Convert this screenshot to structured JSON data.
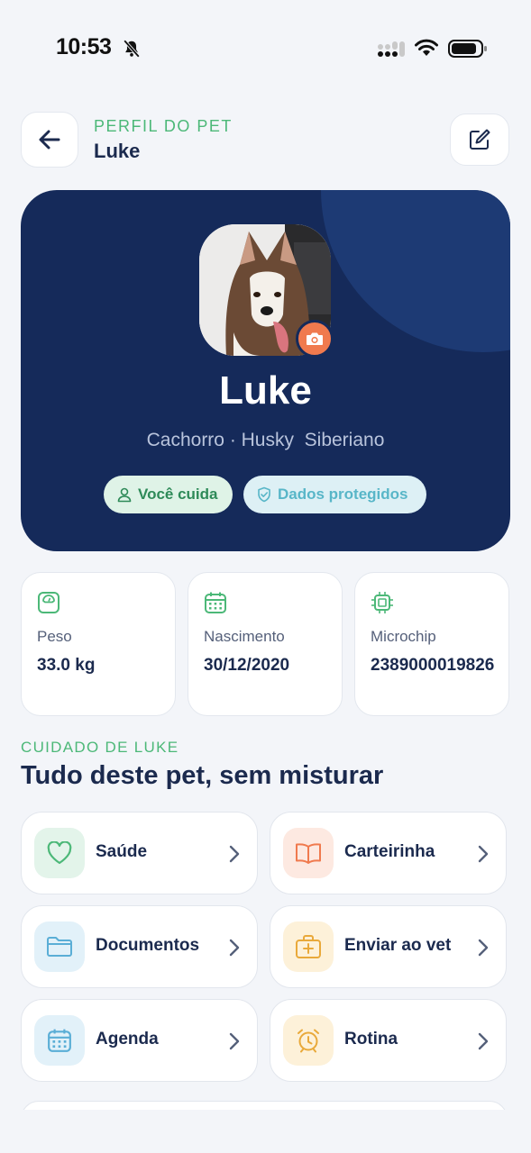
{
  "status_bar": {
    "time": "10:53"
  },
  "header": {
    "eyebrow": "PERFIL DO PET",
    "title": "Luke"
  },
  "hero": {
    "name": "Luke",
    "description": "Cachorro · Husky  Siberiano",
    "chips": [
      "Você cuida",
      "Dados protegidos"
    ]
  },
  "info": [
    {
      "label": "Peso",
      "value": "33.0 kg",
      "icon": "scale-icon"
    },
    {
      "label": "Nascimento",
      "value": "30/12/2020",
      "icon": "calendar-icon"
    },
    {
      "label": "Microchip",
      "value": "2389000019826",
      "icon": "chip-icon"
    }
  ],
  "section": {
    "eyebrow": "CUIDADO DE LUKE",
    "title": "Tudo deste pet, sem misturar"
  },
  "menu": [
    {
      "label": "Saúde",
      "icon": "heart-icon",
      "color": "#4cb878"
    },
    {
      "label": "Carteirinha",
      "icon": "book-icon",
      "color": "#f07a4e"
    },
    {
      "label": "Documentos",
      "icon": "folder-icon",
      "color": "#5aaed6"
    },
    {
      "label": "Enviar ao vet",
      "icon": "medical-kit-icon",
      "color": "#e9a93a"
    },
    {
      "label": "Agenda",
      "icon": "calendar-icon",
      "color": "#5aaed6"
    },
    {
      "label": "Rotina",
      "icon": "alarm-clock-icon",
      "color": "#e9a93a"
    }
  ],
  "colors": {
    "navy": "#152a5a",
    "green": "#4cb878",
    "orange": "#f07a4e",
    "background": "#f3f5f9"
  }
}
